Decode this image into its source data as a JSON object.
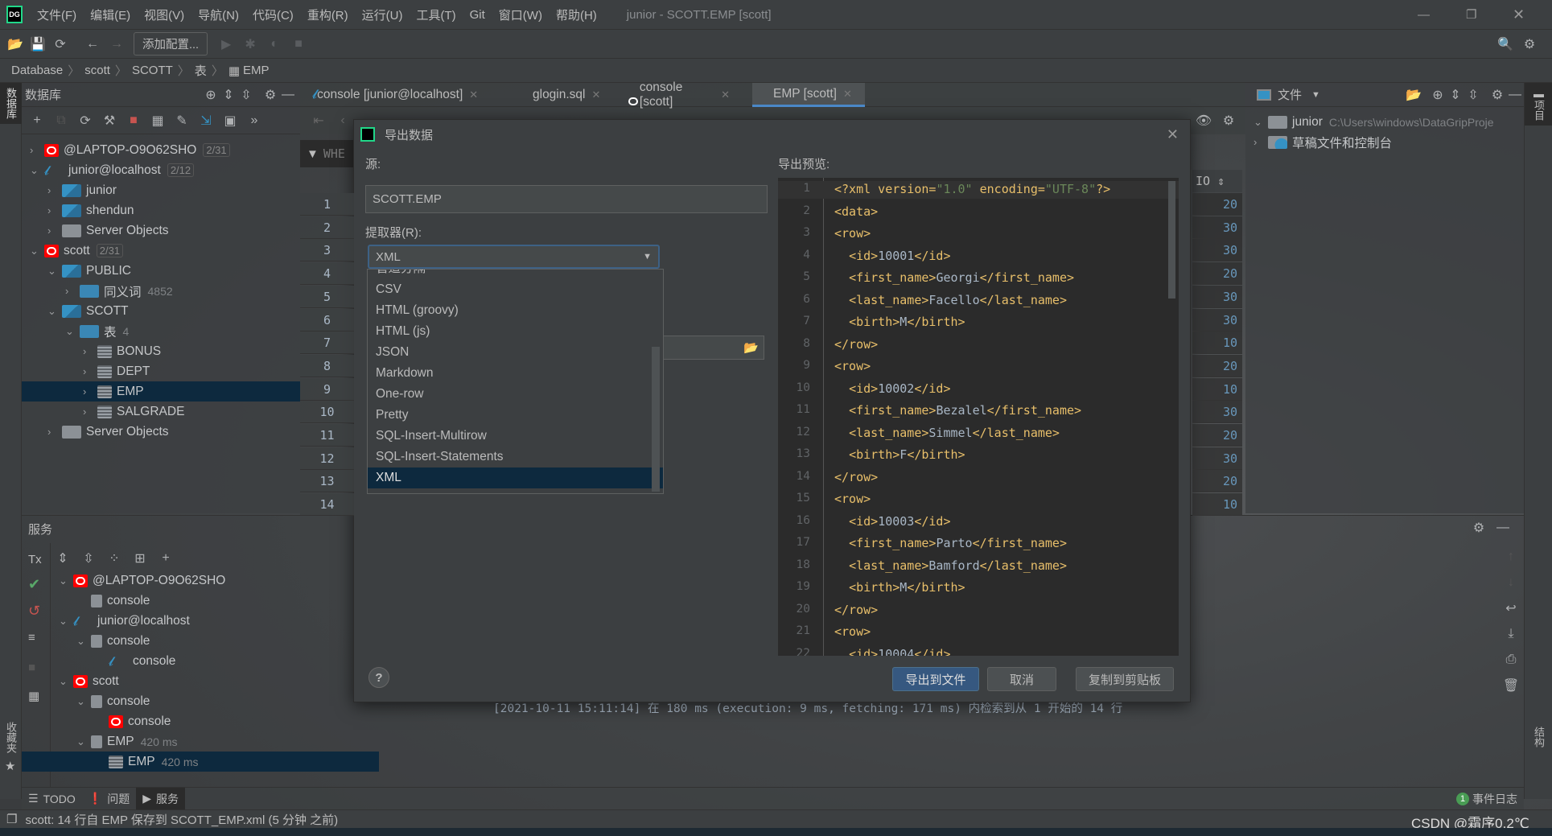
{
  "app": {
    "title": "junior - SCOTT.EMP [scott]",
    "logo": "DG"
  },
  "menu": [
    "文件(F)",
    "编辑(E)",
    "视图(V)",
    "导航(N)",
    "代码(C)",
    "重构(R)",
    "运行(U)",
    "工具(T)",
    "Git",
    "窗口(W)",
    "帮助(H)"
  ],
  "toolbar": {
    "add_config": "添加配置..."
  },
  "breadcrumb": [
    "Database",
    "scott",
    "SCOTT",
    "表",
    "EMP"
  ],
  "db_panel": {
    "title": "数据库",
    "side_label": "数据库",
    "tree": [
      {
        "label": "@LAPTOP-O9O62SHO",
        "badge": "2/31",
        "icon": "oracle",
        "level": 0,
        "arrow": "›"
      },
      {
        "label": "junior@localhost",
        "badge": "2/12",
        "icon": "mysql",
        "level": 0,
        "arrow": "⌄"
      },
      {
        "label": "junior",
        "icon": "schema",
        "level": 1,
        "arrow": "›"
      },
      {
        "label": "shendun",
        "icon": "schema",
        "level": 1,
        "arrow": "›"
      },
      {
        "label": "Server Objects",
        "icon": "server",
        "level": 1,
        "arrow": "›"
      },
      {
        "label": "scott",
        "badge": "2/31",
        "icon": "oracle",
        "level": 0,
        "arrow": "⌄"
      },
      {
        "label": "PUBLIC",
        "icon": "schema",
        "level": 1,
        "arrow": "⌄"
      },
      {
        "label": "同义词",
        "muted": "4852",
        "icon": "folder",
        "level": 2,
        "arrow": "›"
      },
      {
        "label": "SCOTT",
        "icon": "schema",
        "level": 1,
        "arrow": "⌄"
      },
      {
        "label": "表",
        "muted": "4",
        "icon": "folder",
        "level": 2,
        "arrow": "⌄"
      },
      {
        "label": "BONUS",
        "icon": "table",
        "level": 3,
        "arrow": "›"
      },
      {
        "label": "DEPT",
        "icon": "table",
        "level": 3,
        "arrow": "›"
      },
      {
        "label": "EMP",
        "icon": "table",
        "level": 3,
        "arrow": "›",
        "selected": true
      },
      {
        "label": "SALGRADE",
        "icon": "table",
        "level": 3,
        "arrow": "›"
      },
      {
        "label": "Server Objects",
        "icon": "server",
        "level": 1,
        "arrow": "›"
      }
    ]
  },
  "editor_tabs": [
    {
      "label": "console [junior@localhost]",
      "icon": "mysql"
    },
    {
      "label": "glogin.sql",
      "icon": "sql"
    },
    {
      "label": "console [scott]",
      "icon": "oracle"
    },
    {
      "label": "EMP [scott]",
      "icon": "table",
      "active": true
    }
  ],
  "grid": {
    "filter_placeholder": "WHE",
    "row_numbers": [
      "1",
      "2",
      "3",
      "4",
      "5",
      "6",
      "7",
      "8",
      "9",
      "10",
      "11",
      "12",
      "13",
      "14"
    ],
    "column_header": "IO",
    "deptno_values": [
      "20",
      "30",
      "30",
      "20",
      "30",
      "30",
      "10",
      "20",
      "10",
      "30",
      "20",
      "30",
      "20",
      "10"
    ]
  },
  "dialog": {
    "title": "导出数据",
    "source_label": "源:",
    "source_value": "SCOTT.EMP",
    "extractor_label": "提取器(R):",
    "extractor_value": "XML",
    "extractor_options": [
      "管道分隔",
      "CSV",
      "HTML (groovy)",
      "HTML (js)",
      "JSON",
      "Markdown",
      "One-row",
      "Pretty",
      "SQL-Insert-Multirow",
      "SQL-Insert-Statements",
      "XML"
    ],
    "preview_label": "导出预览:",
    "preview_lines": [
      "<?xml version=\"1.0\" encoding=\"UTF-8\"?>",
      "<data>",
      "<row>",
      "  <id>10001</id>",
      "  <first_name>Georgi</first_name>",
      "  <last_name>Facello</last_name>",
      "  <birth>M</birth>",
      "</row>",
      "<row>",
      "  <id>10002</id>",
      "  <first_name>Bezalel</first_name>",
      "  <last_name>Simmel</last_name>",
      "  <birth>F</birth>",
      "</row>",
      "<row>",
      "  <id>10003</id>",
      "  <first_name>Parto</first_name>",
      "  <last_name>Bamford</last_name>",
      "  <birth>M</birth>",
      "</row>",
      "<row>",
      "  <id>10004</id>"
    ],
    "help": "?",
    "export_button": "导出到文件",
    "cancel_button": "取消",
    "copy_button": "复制到剪贴板"
  },
  "project_panel": {
    "dropdown": "文件",
    "side_label": "项目",
    "tree": [
      {
        "label": "junior",
        "path": "C:\\Users\\windows\\DataGripProje",
        "arrow": "⌄"
      },
      {
        "label": "草稿文件和控制台",
        "arrow": "›"
      }
    ]
  },
  "services": {
    "title": "服务",
    "tx": "Tx",
    "favorites_label": "收藏夹",
    "tree": [
      {
        "label": "@LAPTOP-O9O62SHO",
        "icon": "oracle",
        "level": 0,
        "arrow": "⌄"
      },
      {
        "label": "console",
        "icon": "conn",
        "level": 1,
        "arrow": ""
      },
      {
        "label": "junior@localhost",
        "icon": "mysql",
        "level": 0,
        "arrow": "⌄"
      },
      {
        "label": "console",
        "icon": "conn",
        "level": 1,
        "arrow": "⌄"
      },
      {
        "label": "console",
        "icon": "mysql",
        "level": 2,
        "arrow": ""
      },
      {
        "label": "scott",
        "icon": "oracle",
        "level": 0,
        "arrow": "⌄"
      },
      {
        "label": "console",
        "icon": "conn",
        "level": 1,
        "arrow": "⌄"
      },
      {
        "label": "console",
        "icon": "oracle",
        "level": 2,
        "arrow": ""
      },
      {
        "label": "EMP",
        "muted": "420 ms",
        "icon": "conn",
        "level": 1,
        "arrow": "⌄"
      },
      {
        "label": "EMP",
        "muted": "420 ms",
        "icon": "table",
        "level": 2,
        "arrow": "",
        "selected": true
      }
    ],
    "output": "[2021-10-11 15:11:14] 在 180 ms (execution: 9 ms, fetching: 171 ms) 内检索到从 1 开始的 14 行"
  },
  "bottom_tabs": [
    {
      "label": "TODO",
      "icon": "list"
    },
    {
      "label": "问题",
      "icon": "warning"
    },
    {
      "label": "服务",
      "icon": "play",
      "active": true
    }
  ],
  "event_log": {
    "count": "1",
    "label": "事件日志"
  },
  "right_strip": {
    "structure_label": "结构"
  },
  "status": {
    "message": "scott: 14 行自 EMP 保存到 SCOTT_EMP.xml (5 分钟 之前)"
  },
  "watermark": "CSDN @霜序0.2℃",
  "colors": {
    "accent": "#365880",
    "selection": "#0d293e",
    "oracle": "#ff0000",
    "mysql": "#3592c4",
    "xml_tag": "#e8bf6a",
    "xml_string": "#6a8759"
  }
}
